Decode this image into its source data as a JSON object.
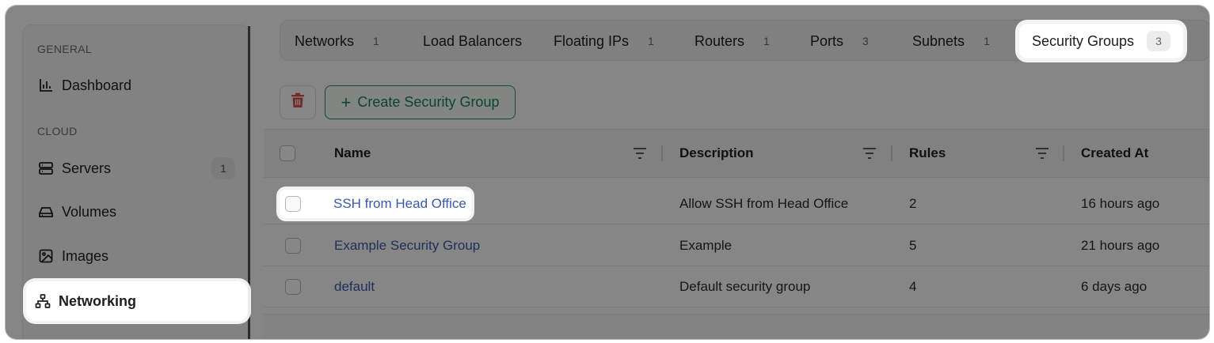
{
  "sidebar": {
    "general_label": "GENERAL",
    "cloud_label": "CLOUD",
    "items": [
      {
        "label": "Dashboard",
        "icon": "bar-chart-icon"
      },
      {
        "label": "Servers",
        "icon": "server-icon",
        "count": "1"
      },
      {
        "label": "Volumes",
        "icon": "hard-drive-icon"
      },
      {
        "label": "Images",
        "icon": "image-icon"
      },
      {
        "label": "Networking",
        "icon": "network-icon",
        "active": true
      }
    ]
  },
  "tabs": [
    {
      "label": "Networks",
      "count": "1"
    },
    {
      "label": "Load Balancers",
      "count": ""
    },
    {
      "label": "Floating IPs",
      "count": "1"
    },
    {
      "label": "Routers",
      "count": "1"
    },
    {
      "label": "Ports",
      "count": "3"
    },
    {
      "label": "Subnets",
      "count": "1"
    },
    {
      "label": "Security Groups",
      "count": "3",
      "active": true
    }
  ],
  "toolbar": {
    "create_label": "Create Security Group",
    "delete_icon": "trash-icon",
    "accent_color": "#1d7d5c",
    "delete_color": "#d9534f"
  },
  "table": {
    "headers": [
      "Name",
      "Description",
      "Rules",
      "Created At"
    ],
    "rows": [
      {
        "name": "SSH from Head Office",
        "description": "Allow SSH from Head Office",
        "rules": "2",
        "created": "16 hours ago"
      },
      {
        "name": "Example Security Group",
        "description": "Example",
        "rules": "5",
        "created": "21 hours ago"
      },
      {
        "name": "default",
        "description": "Default security group",
        "rules": "4",
        "created": "6 days ago"
      }
    ]
  }
}
